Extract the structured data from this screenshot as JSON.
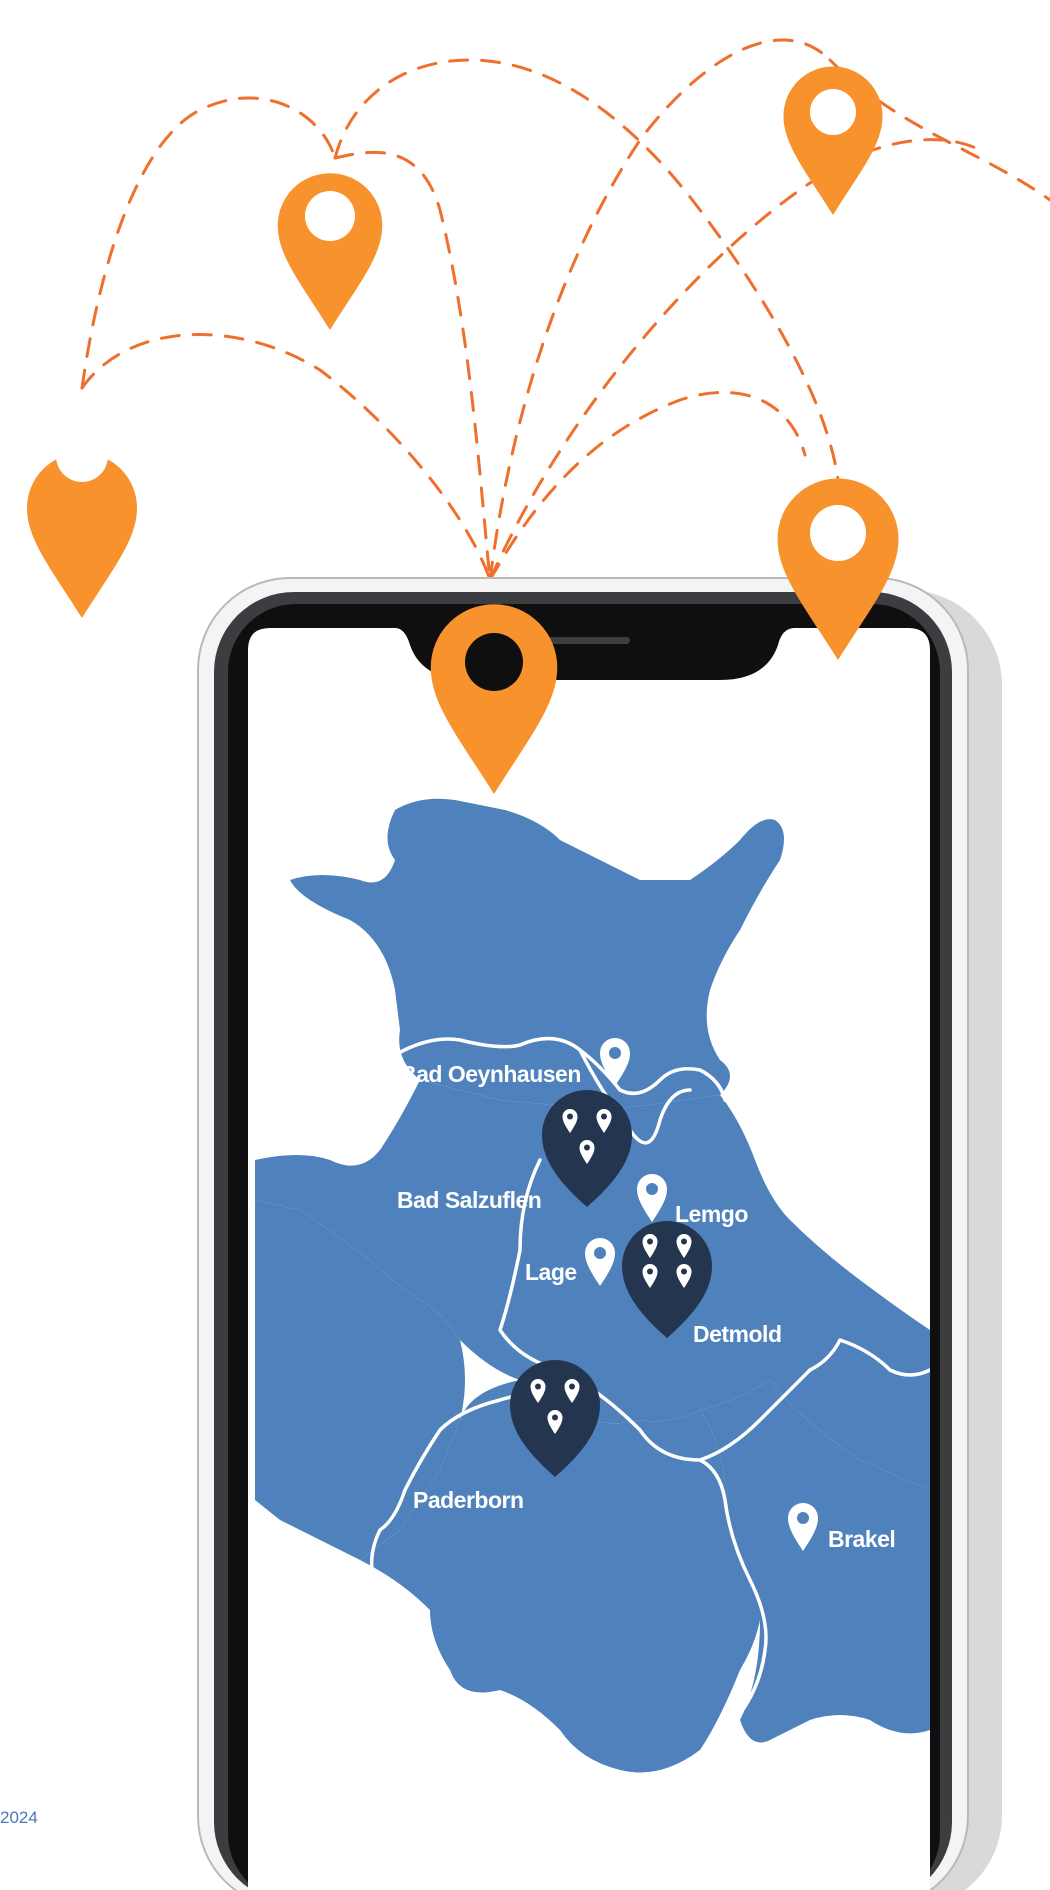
{
  "colors": {
    "accent_orange": "#f7922d",
    "map_blue": "#4f82bd",
    "cluster_navy": "#243550",
    "phone_frame": "#111111",
    "route_dash": "#ef6f2e"
  },
  "map": {
    "cities": {
      "bad_oeynhausen": "Bad Oeynhausen",
      "bad_salzuflen": "Bad Salzuflen",
      "lemgo": "Lemgo",
      "lage": "Lage",
      "detmold": "Detmold",
      "paderborn": "Paderborn",
      "brakel": "Brakel"
    },
    "icons": {
      "city_marker": "map-pin-icon",
      "cluster_marker": "location-cluster-icon",
      "floating_marker": "map-pin-icon"
    }
  },
  "footer": {
    "year_text": "2024"
  }
}
